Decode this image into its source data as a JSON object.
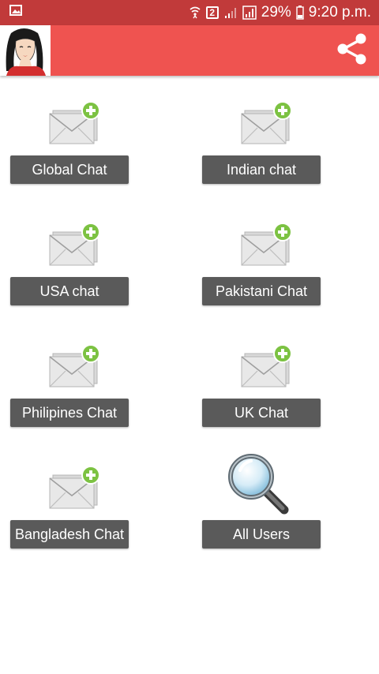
{
  "status_bar": {
    "battery": "29%",
    "time": "9:20 p.m.",
    "sim": "2",
    "icons": [
      "gallery-icon",
      "wifi-icon",
      "sim-2-icon",
      "signal-weak-icon",
      "signal-icon",
      "battery-icon"
    ]
  },
  "app_bar": {
    "avatar_icon": "profile-avatar",
    "share_icon": "share-icon",
    "background": "#ef5350",
    "status_background": "#c13a3a"
  },
  "rooms": [
    {
      "label": "Global Chat",
      "icon": "mail-add-icon"
    },
    {
      "label": "Indian chat",
      "icon": "mail-add-icon"
    },
    {
      "label": "USA chat",
      "icon": "mail-add-icon"
    },
    {
      "label": "Pakistani Chat",
      "icon": "mail-add-icon"
    },
    {
      "label": "Philipines Chat",
      "icon": "mail-add-icon"
    },
    {
      "label": "UK Chat",
      "icon": "mail-add-icon"
    },
    {
      "label": "Bangladesh Chat",
      "icon": "mail-add-icon"
    },
    {
      "label": "All Users",
      "icon": "magnifier-icon"
    }
  ],
  "colors": {
    "button": "#5a5a5a",
    "plus_badge": "#7cc242"
  }
}
